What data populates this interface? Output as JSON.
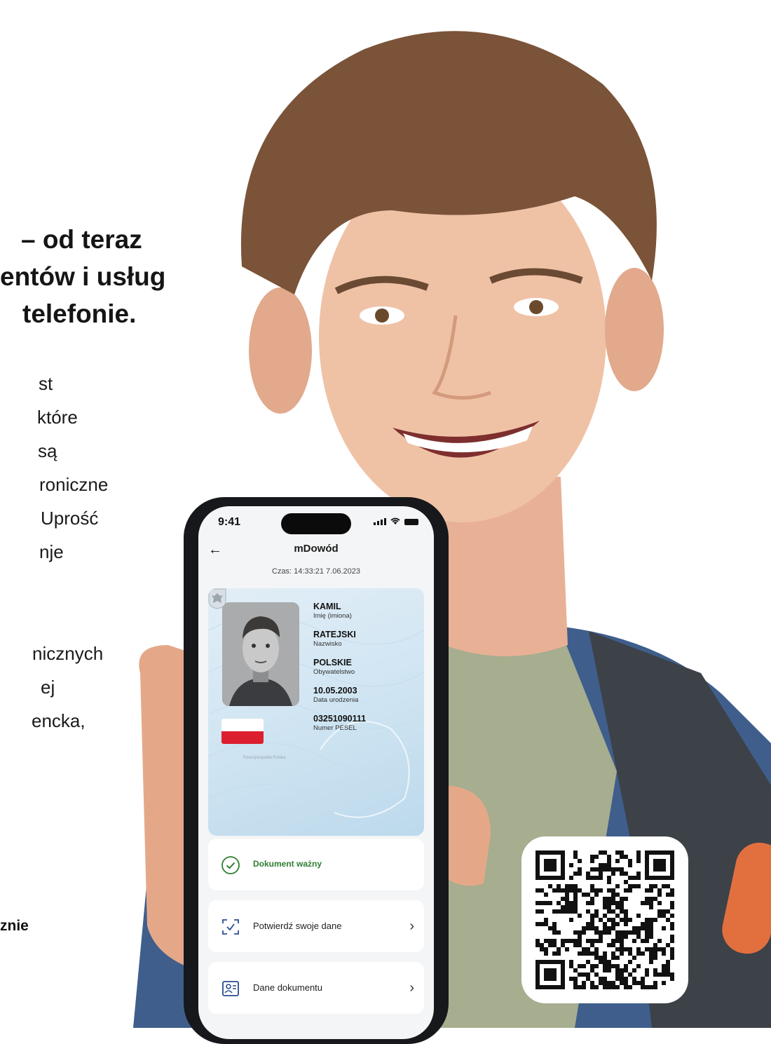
{
  "headline": {
    "line1": "– od teraz",
    "line2": "entów i usług",
    "line3": "telefonie."
  },
  "body": {
    "p1": [
      "st",
      "które",
      "są",
      "roniczne",
      "Uprość",
      "nje"
    ],
    "p2": [
      "nicznych",
      "ej",
      "encka,"
    ]
  },
  "footnote": "znie",
  "phone": {
    "status_time": "9:41",
    "app_title": "mDowód",
    "timestamp": "Czas: 14:33:21 7.06.2023",
    "card": {
      "issuer": "Rzeczpospolita Polska",
      "fields": [
        {
          "value": "KAMIL",
          "label": "Imię (imiona)"
        },
        {
          "value": "RATEJSKI",
          "label": "Nazwisko"
        },
        {
          "value": "POLSKIE",
          "label": "Obywatelstwo"
        },
        {
          "value": "10.05.2003",
          "label": "Data urodzenia"
        },
        {
          "value": "03251090111",
          "label": "Numer PESEL"
        }
      ]
    },
    "status_label": "Dokument ważny",
    "actions": [
      {
        "label": "Potwierdź swoje dane",
        "icon": "scan-check-icon"
      },
      {
        "label": "Dane dokumentu",
        "icon": "id-card-icon"
      }
    ]
  },
  "colors": {
    "valid_green": "#2f7d32",
    "flag_red": "#dc1f2f",
    "card_blue": "#d2e6f3",
    "phone_frame": "#17181b"
  }
}
